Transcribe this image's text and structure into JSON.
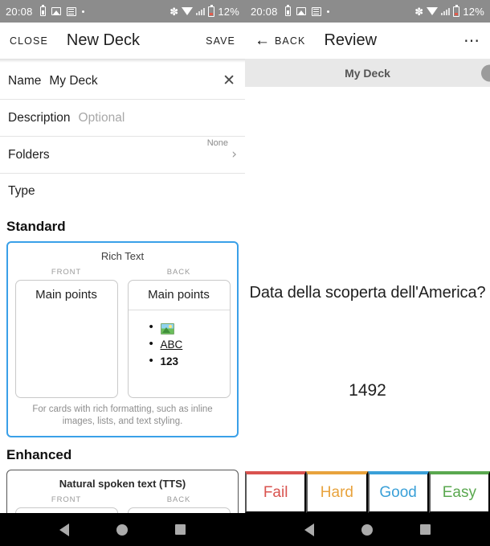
{
  "status_bar": {
    "time": "20:08",
    "battery_percent": "12%",
    "icons": [
      "battery-saver-icon",
      "image-icon",
      "list-icon",
      "dot-icon",
      "bluetooth-icon",
      "wifi-icon",
      "signal-icon",
      "battery-icon"
    ],
    "bluetooth_glyph": "✽",
    "background": "#8c8c8c"
  },
  "left_pane": {
    "appbar": {
      "close_label": "CLOSE",
      "title": "New Deck",
      "save_label": "SAVE"
    },
    "form": {
      "name": {
        "label": "Name",
        "value": "My Deck",
        "clear_icon": "✕"
      },
      "description": {
        "label": "Description",
        "placeholder": "Optional"
      },
      "folders": {
        "label": "Folders",
        "value": "None",
        "chevron": "›"
      },
      "type": {
        "label": "Type"
      }
    },
    "sections": [
      {
        "heading": "Standard",
        "card": {
          "title": "Rich Text",
          "selected": true,
          "front_label": "FRONT",
          "back_label": "BACK",
          "front_title": "Main points",
          "back_title": "Main points",
          "back_bullets": [
            "image-thumbnail",
            "ABC",
            "123"
          ],
          "description": "For cards with rich formatting, such as inline images, lists, and text styling.",
          "accent": "#3aa0e8"
        }
      },
      {
        "heading": "Enhanced",
        "card": {
          "title": "Natural spoken text (TTS)",
          "selected": false,
          "front_label": "FRONT",
          "back_label": "BACK"
        }
      }
    ]
  },
  "right_pane": {
    "appbar": {
      "back_label": "BACK",
      "back_icon": "←",
      "title": "Review",
      "overflow_icon": "⋯"
    },
    "deck_bar": {
      "title": "My Deck"
    },
    "card": {
      "question": "Data della scoperta dell'America?",
      "answer": "1492"
    },
    "ratings": [
      {
        "label": "Fail",
        "color": "#d9534f"
      },
      {
        "label": "Hard",
        "color": "#e8a33d"
      },
      {
        "label": "Good",
        "color": "#3aa0d8"
      },
      {
        "label": "Easy",
        "color": "#5aa84f"
      }
    ]
  },
  "nav_bar": {
    "back": "back-triangle-icon",
    "home": "home-circle-icon",
    "recents": "recents-square-icon"
  }
}
